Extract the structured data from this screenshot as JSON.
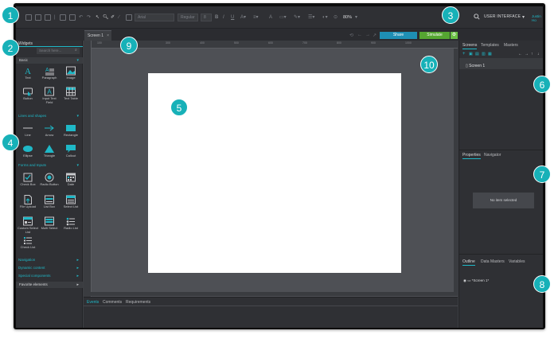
{
  "toolbar": {
    "font_family": "Arial",
    "font_style": "Regular",
    "font_size": "8",
    "zoom": "80%",
    "ui_selector": "USER INTERFACE",
    "user": "Justin Ho"
  },
  "header": {
    "screen_tab": "Screen 1",
    "share_label": "Share",
    "simulate_label": "Simulate"
  },
  "left_panel": {
    "tab": "Widgets",
    "search_placeholder": "Search here...",
    "basic_label": "Basic",
    "basic_widgets": [
      "Text",
      "Paragraph",
      "Image",
      "Button",
      "Input Text Field",
      "Text Table"
    ],
    "lines_label": "Lines and shapes",
    "lines_widgets": [
      "Line",
      "Arrow",
      "Rectangle",
      "Ellipse",
      "Triangle",
      "Callout"
    ],
    "forms_label": "Forms and Inputs",
    "forms_widgets": [
      "Check Box",
      "Radio Button",
      "Date",
      "File Upload",
      "List Box",
      "Select List",
      "Custom Select List",
      "Multi Select",
      "Radio List",
      "Check List"
    ],
    "categories": [
      "Navigation",
      "Dynamic content",
      "Special components",
      "Favorite elements"
    ]
  },
  "bottom_tabs": [
    "Events",
    "Comments",
    "Requirements"
  ],
  "right_panel": {
    "tabs_top": [
      "Screens",
      "Templates",
      "Masters"
    ],
    "screen_item": "Screen 1",
    "tabs_middle": [
      "Properties",
      "Navigator"
    ],
    "no_item": "No item selected",
    "tabs_bottom": [
      "Outline",
      "Data Masters",
      "Variables"
    ],
    "outline_item": "*Screen 1*"
  },
  "ruler_ticks": [
    "100",
    "200",
    "300",
    "400",
    "500",
    "600",
    "700",
    "800",
    "900",
    "1000"
  ],
  "callouts": [
    "1",
    "2",
    "3",
    "4",
    "5",
    "6",
    "7",
    "8",
    "9",
    "10"
  ],
  "colors": {
    "accent": "#1fb8c7",
    "share": "#1e8fb5",
    "simulate": "#55a631",
    "callout": "#17b1b8"
  }
}
